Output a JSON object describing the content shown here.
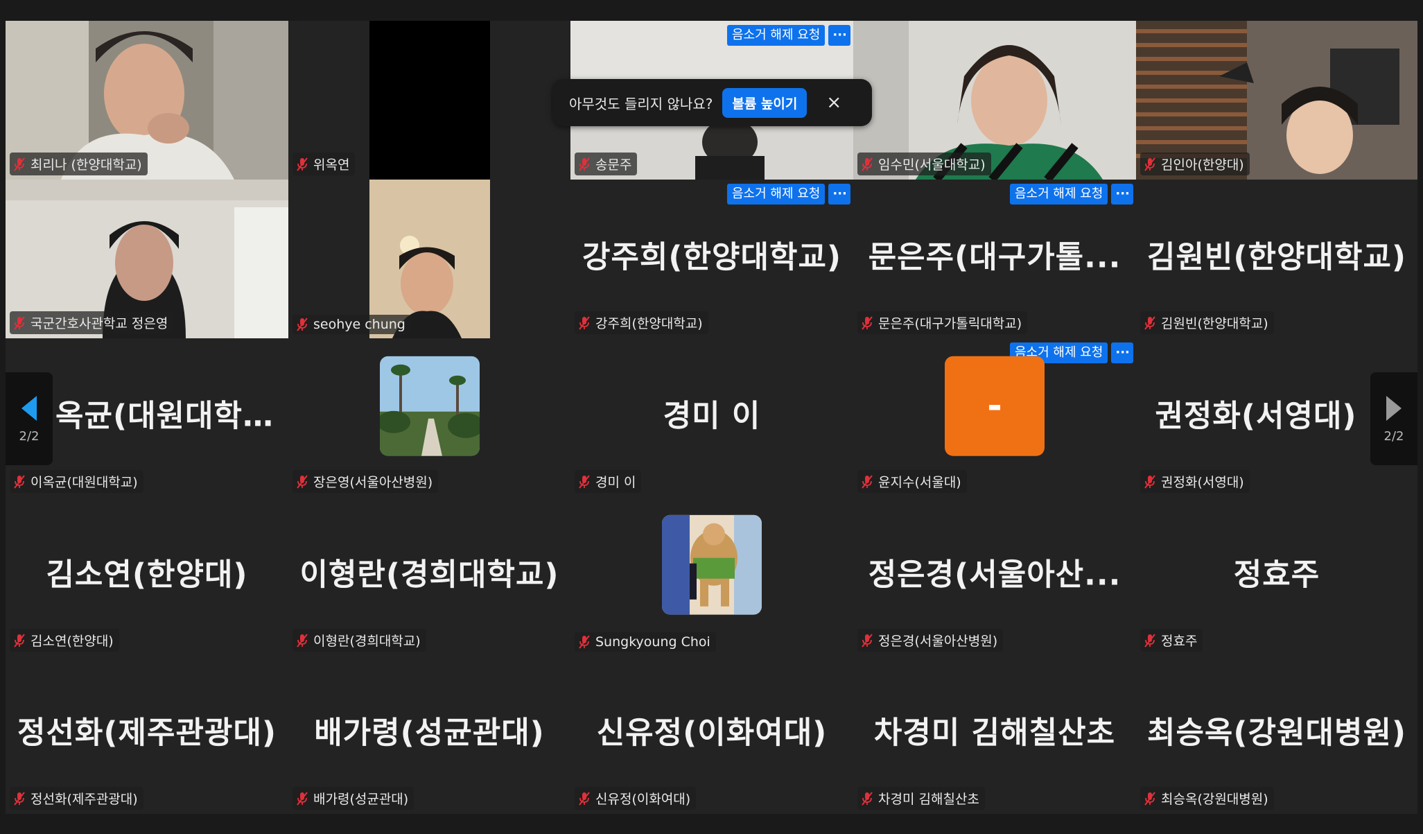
{
  "controls": {
    "unmute_request": "음소거 해제 요청",
    "more": "···",
    "prev_page": "2/2",
    "next_page": "2/2"
  },
  "toast": {
    "message": "아무것도 들리지 않나요?",
    "button": "볼륨 높이기",
    "close": "×"
  },
  "tiles": {
    "choirina": {
      "label": "최리나 (한양대학교)"
    },
    "wiokyeon": {
      "label": "위옥연"
    },
    "songmunju": {
      "label": "송문주"
    },
    "imsumin": {
      "label": "임수민(서울대학교)"
    },
    "kiminah": {
      "label": "김인아(한양대)"
    },
    "jungeunyoung": {
      "label": "국군간호사관학교 정은영"
    },
    "seohye": {
      "label": "seohye chung"
    },
    "kangjuhee": {
      "big": "강주희(한양대학교)",
      "label": "강주희(한양대학교)"
    },
    "moneunju": {
      "big": "문은주(대구가톨...",
      "label": "문은주(대구가톨릭대학교)"
    },
    "kimwonbin": {
      "big": "김원빈(한양대학교)",
      "label": "김원빈(한양대학교)"
    },
    "leeokgyun": {
      "big": "옥균(대원대학교)",
      "label": "이옥균(대원대학교)"
    },
    "jangeunyoung": {
      "label": "장은영(서울아산병원)"
    },
    "kyungmi": {
      "big": "경미 이",
      "label": "경미 이"
    },
    "yunjisu": {
      "avatar": "-",
      "label": "윤지수(서울대)"
    },
    "kwonjunghwa": {
      "big": "권정화(서영대)",
      "label": "권정화(서영대)"
    },
    "kimsoyeon": {
      "big": "김소연(한양대)",
      "label": "김소연(한양대)"
    },
    "leehyungran": {
      "big": "이형란(경희대학교)",
      "label": "이형란(경희대학교)"
    },
    "sungkyoung": {
      "label": "Sungkyoung Choi"
    },
    "jungeunkyung": {
      "big": "정은경(서울아산...",
      "label": "정은경(서울아산병원)"
    },
    "junghyoju": {
      "big": "정효주",
      "label": "정효주"
    },
    "jungsunhwa": {
      "big": "정선화(제주관광대)",
      "label": "정선화(제주관광대)"
    },
    "baegaryung": {
      "big": "배가령(성균관대)",
      "label": "배가령(성균관대)"
    },
    "shinyujung": {
      "big": "신유정(이화여대)",
      "label": "신유정(이화여대)"
    },
    "chakyungmi": {
      "big": "차경미 김해칠산초",
      "label": "차경미 김해칠산초"
    },
    "choiseungok": {
      "big": "최승옥(강원대병원)",
      "label": "최승옥(강원대병원)"
    }
  },
  "colors": {
    "accent": "#0e72ed",
    "muted_mic": "#e0303a",
    "avatar_orange": "#f07114",
    "background": "#232323"
  }
}
